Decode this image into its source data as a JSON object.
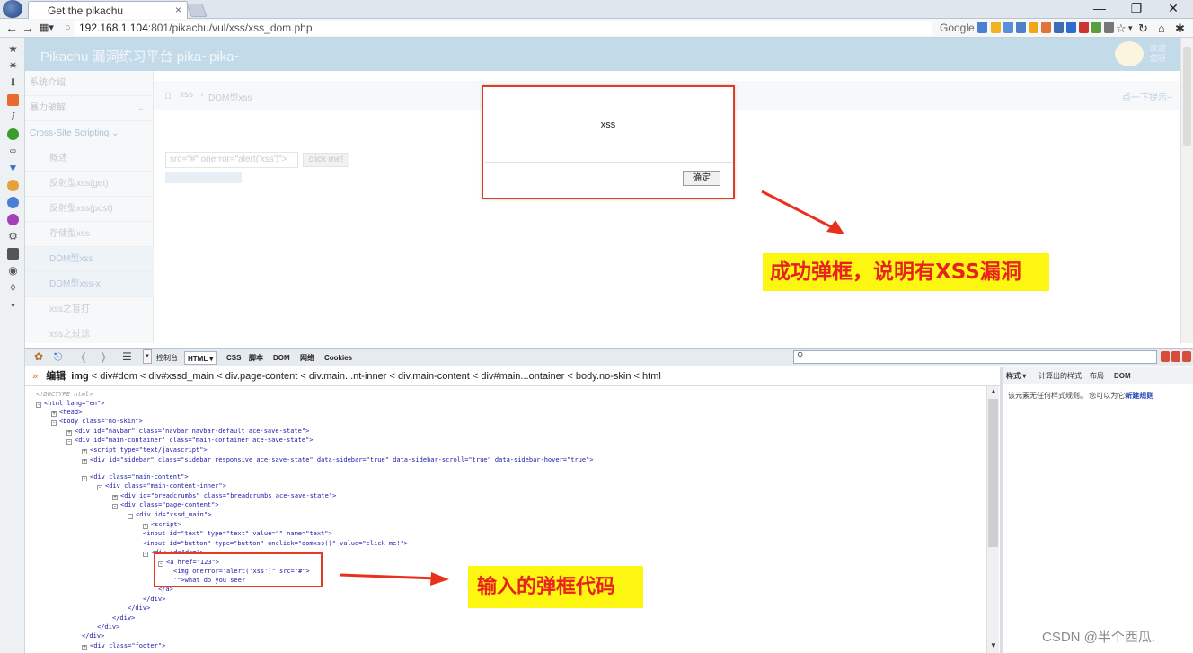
{
  "browser": {
    "tab_title": "Get the pikachu",
    "tab_close": "×",
    "url_host": "192.168.1.104",
    "url_path": ":801/pikachu/vul/xss/xss_dom.php",
    "search_label": "Google",
    "win_min": "—",
    "win_max": "❐",
    "win_close": "✕"
  },
  "page": {
    "brand": "Pikachu 漏洞练习平台 pika~pika~",
    "welcome": "欢迎\n您呀",
    "sidebar": [
      {
        "label": "系统介绍"
      },
      {
        "label": "暴力破解"
      },
      {
        "label": "Cross-Site Scripting"
      },
      {
        "label": "概述"
      },
      {
        "label": "反射型xss(get)"
      },
      {
        "label": "反射型xss(post)"
      },
      {
        "label": "存储型xss"
      },
      {
        "label": "DOM型xss"
      },
      {
        "label": "DOM型xss-x"
      },
      {
        "label": "xss之盲打"
      },
      {
        "label": "xss之过滤"
      }
    ],
    "breadcrumb_home": "xss",
    "breadcrumb_current": "DOM型xss",
    "hint": "点一下提示~",
    "input_value": "src=\"#\" onerror=\"alert('xss')\">",
    "button_label": "click me!"
  },
  "alert": {
    "message": "xss",
    "ok_label": "确定"
  },
  "annotations": {
    "popup_note": "成功弹框，说明有XSS漏洞",
    "code_note": "输入的弹框代码"
  },
  "firebug": {
    "tabs": [
      "控制台",
      "HTML",
      "CSS",
      "脚本",
      "DOM",
      "网络",
      "Cookies"
    ],
    "edit_label": "编辑",
    "path": [
      "img",
      "div#dom",
      "div#xssd_main",
      "div.page-content",
      "div.main...nt-inner",
      "div.main-content",
      "div#main...ontainer",
      "body.no-skin",
      "html"
    ],
    "side_tabs": [
      "样式",
      "计算出的样式",
      "布局",
      "DOM"
    ],
    "side_msg": "该元素无任何样式规则。 您可以为它",
    "side_link": "新建规则",
    "code_lines": [
      "<!DOCTYPE html>",
      "<html lang=\"en\">",
      "<head>",
      "<body class=\"no-skin\">",
      "<div id=\"navbar\" class=\"navbar navbar-default ace-save-state\">",
      "<div id=\"main-container\" class=\"main-container ace-save-state\">",
      "<script type=\"text/javascript\">",
      "<div id=\"sidebar\" class=\"sidebar responsive ace-save-state\" data-sidebar=\"true\" data-sidebar-scroll=\"true\" data-sidebar-hover=\"true\">",
      "<div class=\"main-content\">",
      "<div class=\"main-content-inner\">",
      "<div id=\"breadcrumbs\" class=\"breadcrumbs ace-save-state\">",
      "<div class=\"page-content\">",
      "<div id=\"xssd_main\">",
      "<script>",
      "<input id=\"text\" type=\"text\" value=\"\" name=\"text\">",
      "<input id=\"button\" type=\"button\" onclick=\"domxss()\" value=\"click me!\">",
      "<div id=\"dom\">",
      "<a href=\"123\">",
      "<img onerror=\"alert('xss')\" src=\"#\">",
      "'\">what do you see?",
      "</a>",
      "</div>",
      "</div>",
      "</div>",
      "</div>",
      "</div>",
      "<div class=\"footer\">"
    ]
  },
  "watermark": "CSDN @半个西瓜."
}
